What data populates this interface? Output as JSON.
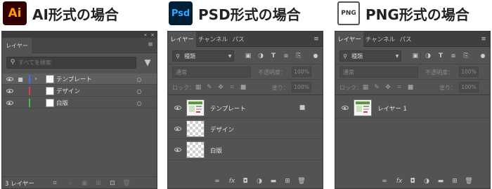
{
  "headings": {
    "ai": "AI形式の場合",
    "psd": "PSD形式の場合",
    "png": "PNG形式の場合"
  },
  "badges": {
    "ai": {
      "text": "Ai",
      "bg": "#330000",
      "fg": "#ff9a00"
    },
    "psd": {
      "text": "Psd",
      "bg": "#001e36",
      "fg": "#31a8ff"
    },
    "png": {
      "text": "PNG",
      "bg": "#ffffff",
      "fg": "#333333"
    }
  },
  "ai_panel": {
    "tab": "レイヤー",
    "search_placeholder": "すべてを検索",
    "layers": [
      {
        "name": "テンプレート",
        "color": "#4a6cff"
      },
      {
        "name": "デザイン",
        "color": "#e04040"
      },
      {
        "name": "白版",
        "color": "#40c040"
      }
    ],
    "count": "3 レイヤー"
  },
  "psd_panel": {
    "tabs": [
      "レイヤー",
      "チャンネル",
      "パス"
    ],
    "kind": "種類",
    "blend": "通常",
    "opacity_label": "不透明度：",
    "opacity_value": "100%",
    "lock_label": "ロック：",
    "fill_label": "塗り：",
    "fill_value": "100%",
    "layers": [
      "テンプレート",
      "デザイン",
      "白版"
    ]
  },
  "png_panel": {
    "tabs": [
      "レイヤー",
      "チャンネル",
      "パス"
    ],
    "kind": "種類",
    "blend": "通常",
    "opacity_label": "不透明度：",
    "opacity_value": "100%",
    "lock_label": "ロック：",
    "fill_label": "塗り：",
    "fill_value": "100%",
    "layers": [
      "レイヤー 1"
    ]
  },
  "colors": {
    "panel_bg": "#535353",
    "tab_bar": "#3f3f3f",
    "selected_row": "#5f5f5f"
  }
}
